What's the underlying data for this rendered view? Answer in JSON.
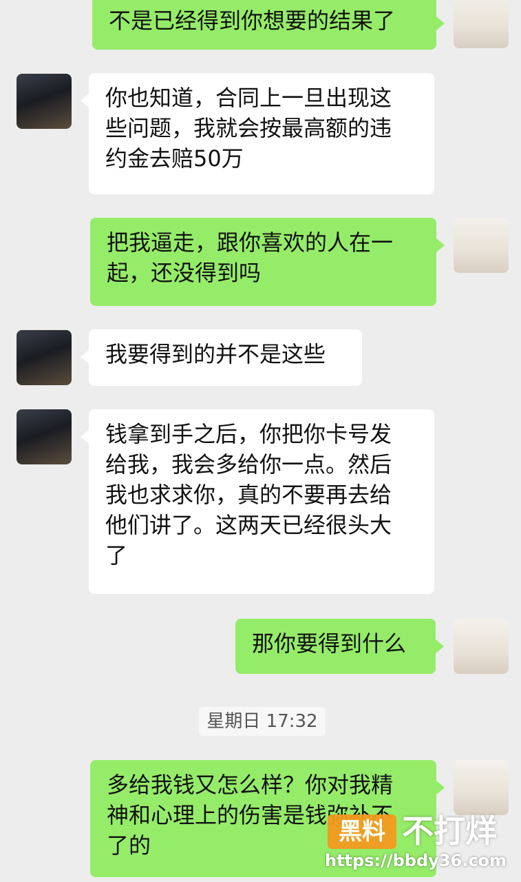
{
  "messages": [
    {
      "side": "out",
      "text": "不是已经得到你想要的结果了"
    },
    {
      "side": "in",
      "text": "你也知道，合同上一旦出现这\n些问题，我就会按最高额的违\n约金去赔50万"
    },
    {
      "side": "out",
      "text": "把我逼走，跟你喜欢的人在一\n起，还没得到吗"
    },
    {
      "side": "in",
      "text": "我要得到的并不是这些"
    },
    {
      "side": "in",
      "text": "钱拿到手之后，你把你卡号发\n给我，我会多给你一点。然后\n我也求求你，真的不要再去给\n他们讲了。这两天已经很头大\n了"
    },
    {
      "side": "out",
      "text": "那你要得到什么"
    },
    {
      "side": "out",
      "text": "多给我钱又怎么样？你对我精\n神和心理上的伤害是钱弥补不\n了的"
    }
  ],
  "timestamp": "星期日 17:32",
  "watermark": {
    "badge": "黑料",
    "text": "不打烊",
    "url": "https://bbdy36.com"
  },
  "colors": {
    "background": "#ededed",
    "incoming_bubble": "#ffffff",
    "outgoing_bubble": "#95ec69",
    "watermark_badge": "#f39a1f"
  }
}
